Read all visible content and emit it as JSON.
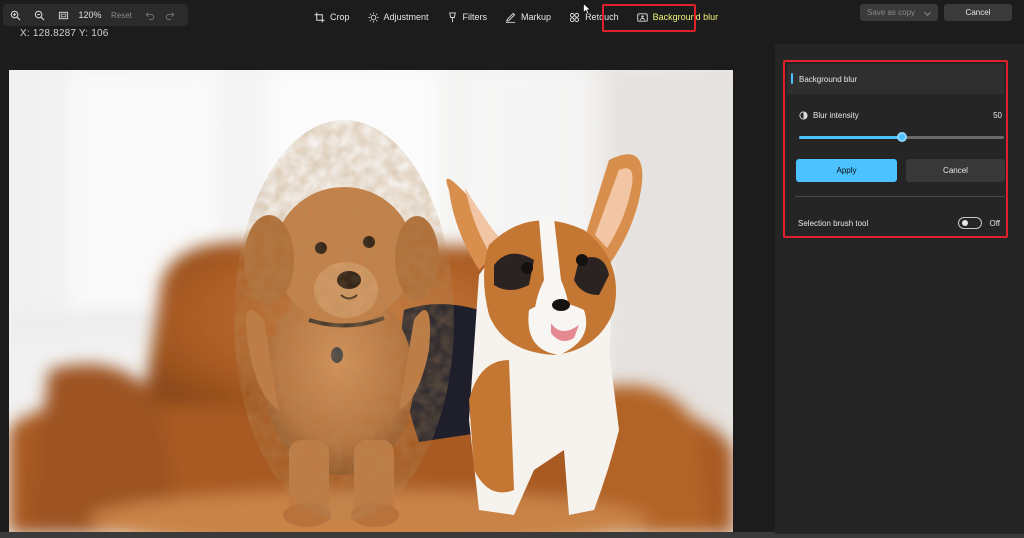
{
  "zoom": {
    "level": "120%",
    "reset_label": "Reset"
  },
  "coords_text": "X: 128.8287 Y: 106",
  "tabs": [
    {
      "label": "Crop",
      "icon": "crop-icon"
    },
    {
      "label": "Adjustment",
      "icon": "brightness-icon"
    },
    {
      "label": "Filters",
      "icon": "filter-icon"
    },
    {
      "label": "Markup",
      "icon": "pen-icon"
    },
    {
      "label": "Retouch",
      "icon": "retouch-icon"
    },
    {
      "label": "Background blur",
      "icon": "background-blur-icon",
      "active": true
    }
  ],
  "actions": {
    "save_as_copy": "Save as copy",
    "cancel": "Cancel"
  },
  "panel": {
    "title": "Background blur",
    "blur_label": "Blur intensity",
    "blur_value": "50",
    "blur_fraction": 0.5,
    "apply_label": "Apply",
    "cancel_label": "Cancel",
    "brush_label": "Selection brush tool",
    "brush_state": "Off"
  },
  "colors": {
    "accent": "#4cc2ff",
    "highlight": "#e0202a",
    "active_tab": "#f0f07a"
  }
}
